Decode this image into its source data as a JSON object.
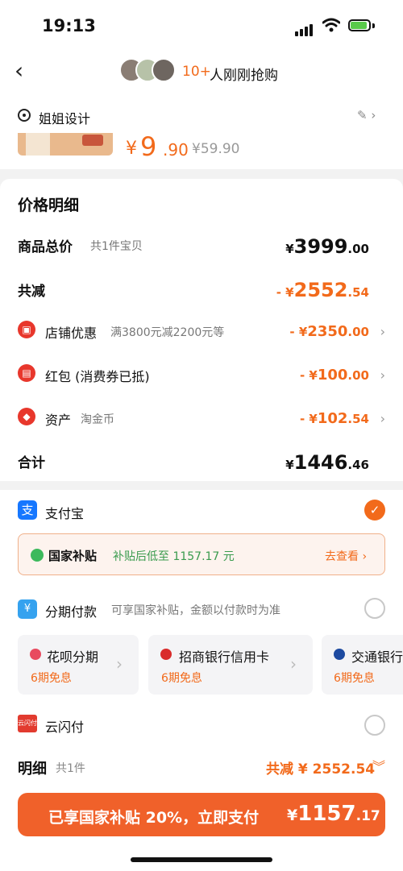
{
  "status": {
    "time": "19:13"
  },
  "nav": {
    "count": "10+",
    "text": "人刚刚抢购"
  },
  "address": {
    "name": "姐姐设计"
  },
  "product": {
    "price_symbol": "¥",
    "price_int": "9",
    "price_dec": ".90",
    "price_old": "¥59.90"
  },
  "details": {
    "title": "价格明细",
    "total": {
      "label": "商品总价",
      "sub": "共1件宝贝",
      "sym": "¥",
      "int": "3999",
      "dec": ".00"
    },
    "reduce": {
      "label": "共减",
      "sym": "- ¥",
      "int": "2552",
      "dec": ".54"
    },
    "shop": {
      "label": "店铺优惠",
      "sub": "满3800元减2200元等",
      "sym": "- ¥",
      "int": "2350",
      "dec": ".00"
    },
    "redpacket": {
      "label": "红包 (消费券已抵)",
      "sym": "- ¥",
      "int": "100",
      "dec": ".00"
    },
    "assets": {
      "label": "资产",
      "sub": "淘金币",
      "sym": "- ¥",
      "int": "102",
      "dec": ".54"
    },
    "sum": {
      "label": "合计",
      "sym": "¥",
      "int": "1446",
      "dec": ".46"
    }
  },
  "payment": {
    "alipay": "支付宝",
    "subsidy": {
      "title": "国家补贴",
      "desc": "补贴后低至 1157.17 元",
      "link": "去查看 ›"
    },
    "installment": {
      "label": "分期付款",
      "note": "可享国家补贴，金额以付款时为准"
    },
    "options": [
      {
        "title": "花呗分期",
        "sub": "6期免息"
      },
      {
        "title": "招商银行信用卡",
        "sub": "6期免息"
      },
      {
        "title": "交通银行",
        "sub": "6期免息"
      }
    ],
    "unionpay": "云闪付",
    "unionpay_icon_text": "云闪付"
  },
  "detail_bar": {
    "label": "明细",
    "count": "共1件",
    "amount": "共减 ¥ 2552.54"
  },
  "pay_button": {
    "text": "已享国家补贴 20%，立即支付",
    "sym": "¥",
    "int": "1157",
    "dec": ".17"
  },
  "colors": {
    "accent": "#f26a1b",
    "alipay": "#1677ff",
    "subsidy_green": "#3a9b4e"
  }
}
